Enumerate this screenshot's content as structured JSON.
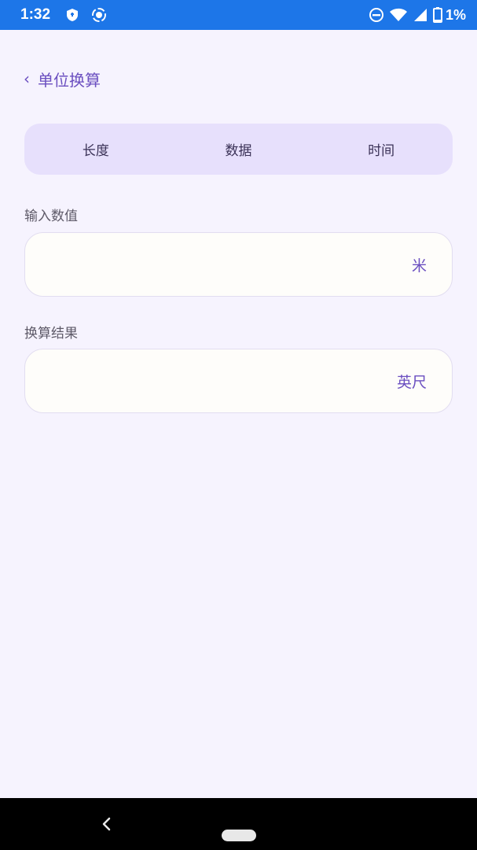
{
  "status_bar": {
    "time": "1:32",
    "battery": "1%",
    "icons": [
      "shield-icon",
      "screen-record-icon",
      "do-not-disturb-icon",
      "wifi-icon",
      "signal-icon",
      "battery-icon"
    ]
  },
  "header": {
    "back_glyph": "‹",
    "title": "单位换算"
  },
  "tabs": [
    {
      "label": "长度"
    },
    {
      "label": "数据"
    },
    {
      "label": "时间"
    }
  ],
  "input": {
    "label": "输入数值",
    "value": "",
    "placeholder": "",
    "unit": "米"
  },
  "result": {
    "label": "换算结果",
    "value": "",
    "placeholder": "",
    "unit": "英尺"
  },
  "colors": {
    "status_bar": "#1d76e8",
    "background": "#f6f3fe",
    "tabs_bg": "#e7e0fc",
    "accent": "#6b4fc0",
    "field_bg": "#fefdfa"
  }
}
